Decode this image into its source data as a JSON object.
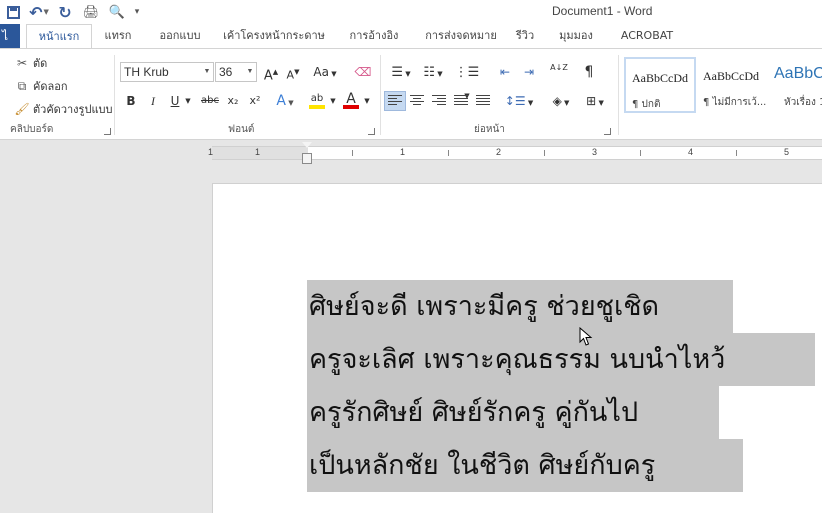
{
  "window": {
    "title": "Document1 - Word"
  },
  "tabs": {
    "file": "ไ",
    "items": [
      {
        "label": "หน้าแรก"
      },
      {
        "label": "แทรก"
      },
      {
        "label": "ออกแบบ"
      },
      {
        "label": "เค้าโครงหน้ากระดาษ"
      },
      {
        "label": "การอ้างอิง"
      },
      {
        "label": "การส่งจดหมาย"
      },
      {
        "label": "รีวิว"
      },
      {
        "label": "มุมมอง"
      },
      {
        "label": "ACROBAT"
      }
    ]
  },
  "clipboard": {
    "cut": "ตัด",
    "copy": "คัดลอก",
    "format_painter": "ตัวคัดวางรูปแบบ",
    "group_label": "คลิปบอร์ด"
  },
  "font": {
    "name": "TH Krub",
    "size": "36",
    "grow": "A",
    "shrink": "A",
    "case": "Aa",
    "bold": "B",
    "italic": "I",
    "underline": "U",
    "strike": "abc",
    "subscript": "x₂",
    "superscript": "x²",
    "effects": "A",
    "highlight": "ab",
    "color": "A",
    "group_label": "ฟอนต์",
    "highlight_color": "#ffe400",
    "font_color": "#e00000"
  },
  "paragraph": {
    "sort": "A↓Z",
    "pilcrow": "¶",
    "group_label": "ย่อหน้า"
  },
  "styles": {
    "items": [
      {
        "sample": "AaBbCcDd",
        "name": "¶ ปกติ"
      },
      {
        "sample": "AaBbCcDd",
        "name": "¶ ไม่มีการเว้..."
      },
      {
        "sample": "AaBbC",
        "name": "หัวเรื่อง 1"
      }
    ]
  },
  "ruler": {
    "numbers": [
      "1",
      "1",
      "1",
      "2",
      "3",
      "4",
      "5"
    ]
  },
  "document": {
    "lines": [
      "ศิษย์จะดี เพราะมีครู ช่วยชูเชิด",
      "ครูจะเลิศ เพราะคุณธรรม นบนำไหว้",
      "ครูรักศิษย์ ศิษย์รักครู คู่กันไป",
      "เป็นหลักชัย ในชีวิต ศิษย์กับครู"
    ]
  }
}
